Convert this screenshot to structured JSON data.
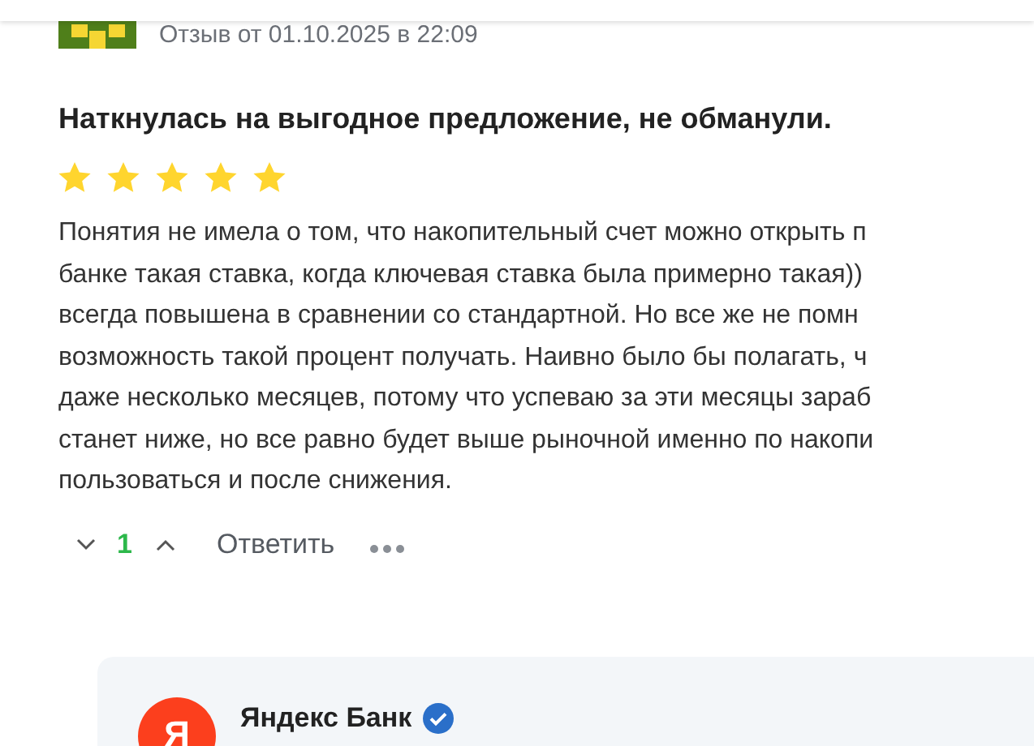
{
  "review": {
    "date": "Отзыв от 01.10.2025 в 22:09",
    "title": "Наткнулась на выгодное предложение, не обманули.",
    "stars": 5,
    "text_lines": [
      "Понятия не имела о том, что накопительный счет можно открыть п",
      "банке такая ставка, когда ключевая ставка была примерно такая))",
      "всегда повышена в сравнении со стандартной. Но все же не помн",
      "возможность такой процент получать. Наивно было бы полагать, ч",
      "даже несколько месяцев, потому что успеваю за эти месяцы зараб",
      "станет ниже, но все равно будет выше рыночной именно по накопи",
      "пользоваться и после снижения."
    ],
    "votes": "1",
    "reply_button": "Ответить"
  },
  "bank_reply": {
    "name": "Яндекс Банк",
    "logo": "Я",
    "verified": true
  }
}
